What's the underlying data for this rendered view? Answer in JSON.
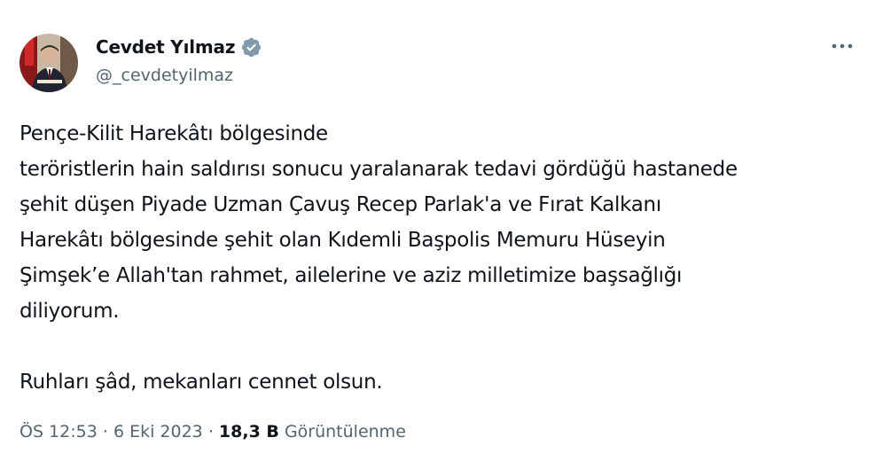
{
  "author": {
    "display_name": "Cevdet Yılmaz",
    "handle": "@_cevdetyilmaz",
    "verified": true
  },
  "tweet": {
    "lines": [
      "Pençe-Kilit Harekâtı bölgesinde",
      "teröristlerin hain saldırısı sonucu yaralanarak tedavi gördüğü hastanede",
      "şehit düşen Piyade Uzman Çavuş Recep Parlak'a ve Fırat Kalkanı",
      "Harekâtı bölgesinde şehit olan Kıdemli Başpolis Memuru Hüseyin",
      "Şimşek’e Allah'tan rahmet, ailelerine ve aziz milletimize başsağlığı",
      "diliyorum."
    ],
    "closing": "Ruhları şâd, mekanları cennet olsun."
  },
  "meta": {
    "time": "ÖS 12:53",
    "separator": "·",
    "date": "6 Eki 2023",
    "views_count": "18,3 B",
    "views_label": "Görüntülenme"
  },
  "icons": {
    "verified": "verified-badge-icon",
    "more": "more-options-icon"
  },
  "colors": {
    "text_primary": "#0f1419",
    "text_secondary": "#536471",
    "verified_badge": "#829aab"
  }
}
